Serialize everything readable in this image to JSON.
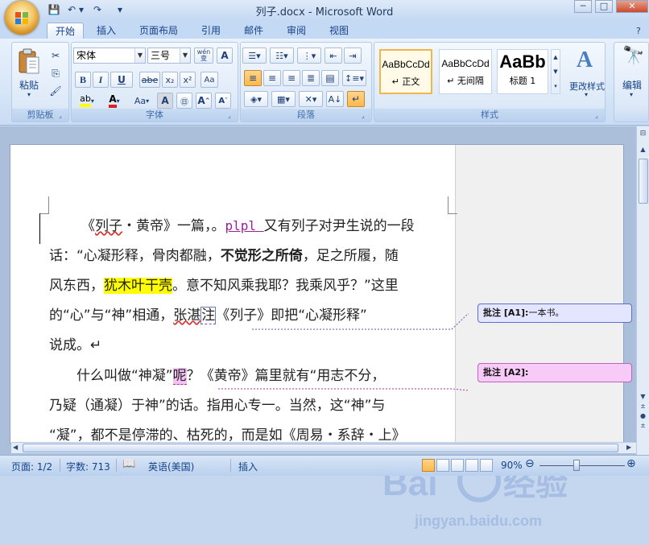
{
  "window": {
    "title": "列子.docx - Microsoft Word",
    "min": "─",
    "max": "□",
    "close": "✕"
  },
  "qat": {
    "save": "💾",
    "undo": "↶",
    "undo_menu": "▾",
    "redo": "↷",
    "customize": "▾"
  },
  "tabs": [
    "开始",
    "插入",
    "页面布局",
    "引用",
    "邮件",
    "审阅",
    "视图"
  ],
  "ribbon": {
    "clipboard": {
      "label": "剪贴板",
      "paste": "粘贴"
    },
    "font": {
      "label": "字体",
      "font_name": "宋体",
      "font_size": "三号",
      "wen": "wén\n变",
      "a_box": "A",
      "bold": "B",
      "italic": "I",
      "underline": "U",
      "strike": "abe",
      "sub": "x₂",
      "sup": "x²",
      "clear": "Aa",
      "grow": "A",
      "shrink": "A",
      "change_case": "Aa"
    },
    "paragraph": {
      "label": "段落"
    },
    "styles": {
      "label": "样式",
      "items": [
        {
          "sample": "AaBbCcDd",
          "name": "↵ 正文"
        },
        {
          "sample": "AaBbCcDd",
          "name": "↵ 无间隔"
        },
        {
          "sample": "AaBb",
          "name": "标题 1"
        }
      ],
      "change_styles": "更改样式"
    },
    "editing": {
      "label": "编辑"
    }
  },
  "document": {
    "line1_a": "《",
    "line1_sq": "列子",
    "line1_b": "・黄帝》一篇，。",
    "line1_ins": "plpl ",
    "line1_c": "又有列子对尹生说的一段",
    "line2_a": "话：“心凝形释，骨肉都融，",
    "line2_bold": "不觉形之所倚",
    "line2_b": "，足之所履，随",
    "line3_a": "风东西，",
    "line3_hl": "犹木叶干壳",
    "line3_b": "。意不知风乘我耶？我乘风乎？”这里",
    "line4_a": "的“心”与“神”相通，",
    "line4_sq": "张湛",
    "line4_cm": "注",
    "line4_b": "《列子》即把“心凝形释”",
    "line5": "说成。↵",
    "line6_a": "　　什么叫做“神凝”",
    "line6_hl": "呢",
    "line6_b": "？《黄帝》篇里就有“用志不分，",
    "line7_a": "乃疑（通凝）于神”的话。指用心专一。当然，这“神”与",
    "line8": "“凝”，都不是停滞的、枯死的，而是如《周易・系辞・上》"
  },
  "comments": [
    {
      "tag": "批注 [A1]:",
      "text": "一本书。"
    },
    {
      "tag": "批注 [A2]:",
      "text": ""
    }
  ],
  "status": {
    "page": "页面: 1/2",
    "words": "字数: 713",
    "language": "英语(美国)",
    "mode": "插入",
    "zoom": "90%"
  },
  "watermark": "Baidu 经验"
}
